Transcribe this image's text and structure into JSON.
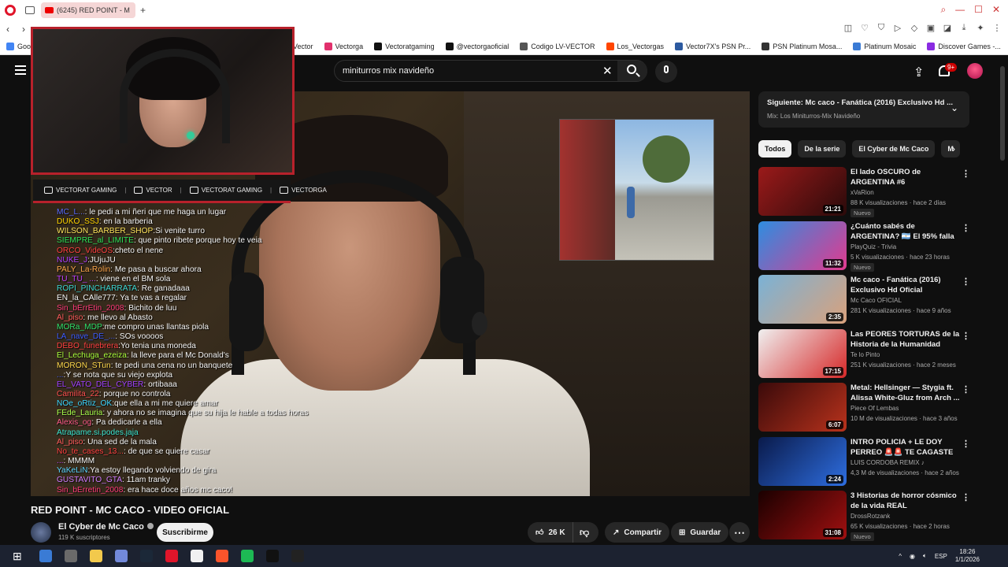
{
  "browser": {
    "tab_title": "(6245) RED POINT - M",
    "bookmarks": [
      {
        "label": "Goog",
        "color": "#4285f4"
      },
      {
        "label": "Vector",
        "color": "#7b4dd8"
      },
      {
        "label": "Vectorga",
        "color": "#e1306c"
      },
      {
        "label": "Vectoratgaming",
        "color": "#111111"
      },
      {
        "label": "@vectorgaoficial",
        "color": "#111111"
      },
      {
        "label": "Codigo LV-VECTOR",
        "color": "#555555"
      },
      {
        "label": "Los_Vectorgas",
        "color": "#ff4500"
      },
      {
        "label": "Vector7X's PSN Pr...",
        "color": "#2c5aa0"
      },
      {
        "label": "PSN Platinum Mosa...",
        "color": "#333333"
      },
      {
        "label": "Platinum Mosaic",
        "color": "#3a7bd5"
      },
      {
        "label": "Discover Games -...",
        "color": "#8a2be2"
      }
    ]
  },
  "youtube": {
    "search_query": "miniturros mix navideño",
    "notifications": "9+"
  },
  "stream": {
    "social": [
      {
        "icon": "youtube-icon",
        "label": "VECTORAT GAMING"
      },
      {
        "icon": "twitch-icon",
        "label": "VECTOR"
      },
      {
        "icon": "twitter-icon",
        "label": "VECTORAT GAMING"
      },
      {
        "icon": "instagram-icon",
        "label": "VECTORGA"
      }
    ],
    "chat": [
      {
        "user": "MC_L...",
        "msg": ": le pedi a mi ñeri que me haga un lugar",
        "color": "#5b6cff"
      },
      {
        "user": "DUKO_SSJ",
        "msg": ": en la barberia",
        "color": "#ffd400"
      },
      {
        "user": "WILSON_BARBER_SHOP",
        "msg": ":Si venite turro",
        "color": "#ffe45c"
      },
      {
        "user": "SIEMPRE_al_LIMITE",
        "msg": ": que pinto ribete porque hoy te veia",
        "color": "#2ee65a"
      },
      {
        "user": "ORCO_VideOS",
        "msg": ":cheto el nene",
        "color": "#ff4040"
      },
      {
        "user": "NUKE_J",
        "msg": ":JUjuJU",
        "color": "#b040ff"
      },
      {
        "user": "PALY_La-Rolin",
        "msg": ": Me pasa a buscar ahora",
        "color": "#ffa84c"
      },
      {
        "user": "TU_TU_ ...",
        "msg": ": viene en el BM sola",
        "color": "#c040ff"
      },
      {
        "user": "ROPI_PINCHARRATA",
        "msg": ": Re ganadaaa",
        "color": "#3dd6d0"
      },
      {
        "user": "EN_la_CAlle777",
        "msg": ": Ya te vas a regalar",
        "color": "#f5f5f5"
      },
      {
        "user": "Sin_bErrEtin_2008",
        "msg": ": Bichito de luu",
        "color": "#ff3c7a"
      },
      {
        "user": "Al_piso",
        "msg": ": me llevo al Abasto",
        "color": "#ff5c5c"
      },
      {
        "user": "MORa_MDP",
        "msg": ":me compro unas llantas piola",
        "color": "#2fe06a"
      },
      {
        "user": "LA_nave_DE_...",
        "msg": ": SOs voooos",
        "color": "#3d5cff"
      },
      {
        "user": "DEBO_funebrera",
        "msg": ":Yo tenia una moneda",
        "color": "#ff4040"
      },
      {
        "user": "El_Lechuga_ezeiza",
        "msg": ": la lleve para el Mc Donald's",
        "color": "#aaff3c"
      },
      {
        "user": "MORON_STun",
        "msg": ": te pedi una cena no un banquete",
        "color": "#ffd84c"
      },
      {
        "user": "...",
        "msg": ":Y se nota que su viejo explota",
        "color": "#3d5cff"
      },
      {
        "user": "EL_VATO_DEL_CYBER",
        "msg": ": ortibaaa",
        "color": "#a040ff"
      },
      {
        "user": "Camilita_22",
        "msg": ": porque no controla",
        "color": "#ff5050"
      },
      {
        "user": "NOe_oRtiz_OK",
        "msg": ":que ella a mi me quiere amar",
        "color": "#3dd6ff"
      },
      {
        "user": "FEde_Lauria",
        "msg": ": y ahora no se imagina que su hija le hable a todas horas",
        "color": "#a8ff4c"
      },
      {
        "user": "Alexis_og",
        "msg": ": Pa dedicarle a ella",
        "color": "#ff5c8a"
      },
      {
        "user": "Atrapame.si.podes.jaja",
        "msg": "",
        "color": "#3de6d0"
      },
      {
        "user": "Al_piso",
        "msg": ": Una sed de la mala",
        "color": "#ff5c5c"
      },
      {
        "user": "No_te_cases_13...",
        "msg": ": de que se quiere casar",
        "color": "#ff4040"
      },
      {
        "user": "...",
        "msg": ": MMMM",
        "color": "#c040ff"
      },
      {
        "user": "YaKeLiN",
        "msg": ":Ya estoy llegando volviendo de gira",
        "color": "#5cd6ff"
      },
      {
        "user": "GUSTAVITO_GTA",
        "msg": ": 11am tranky",
        "color": "#d07cff"
      },
      {
        "user": "Sin_bErretin_2008",
        "msg": ": era hace doce años mc caco!",
        "color": "#ff3c7a"
      }
    ]
  },
  "video": {
    "title": "RED POINT - MC CACO - VIDEO OFICIAL",
    "channel": "El Cyber de Mc Caco",
    "subscribers": "119 K suscriptores",
    "subscribe_label": "Suscribirme",
    "likes": "26 K",
    "share_label": "Compartir",
    "save_label": "Guardar"
  },
  "sidebar": {
    "next_title": "Siguiente: Mc caco - Fanática (2016) Exclusivo Hd ...",
    "next_sub": "Mix: Los Miniturros-Mix Navideño",
    "chips": [
      "Todos",
      "De la serie",
      "El Cyber de Mc Caco",
      "M"
    ],
    "recommendations": [
      {
        "title": "El lado OSCURO de ARGENTINA #6",
        "channel": "xVaRion",
        "meta": "88 K visualizaciones · hace 2 días",
        "badge": "Nuevo",
        "duration": "21:21",
        "thumb_a": "#9b1a1a",
        "thumb_b": "#2a0a0a"
      },
      {
        "title": "¿Cuánto sabés de ARGENTINA? 🇦🇷 El 95% falla la última ...",
        "channel": "PlayQuiz - Trivia",
        "meta": "5 K visualizaciones · hace 23 horas",
        "badge": "Nuevo",
        "duration": "11:32",
        "thumb_a": "#2e8de0",
        "thumb_b": "#e23a8f"
      },
      {
        "title": "Mc caco - Fanática (2016) Exclusivo Hd Oficial",
        "channel": "Mc Caco OFICIAL",
        "meta": "281 K visualizaciones · hace 9 años",
        "badge": "",
        "duration": "2:35",
        "thumb_a": "#7ab2d6",
        "thumb_b": "#d9a17c"
      },
      {
        "title": "Las PEORES TORTURAS de la Historia de la Humanidad",
        "channel": "Te lo Pinto",
        "meta": "251 K visualizaciones · hace 2 meses",
        "badge": "",
        "duration": "17:15",
        "thumb_a": "#f0f0f0",
        "thumb_b": "#d62828"
      },
      {
        "title": "Metal: Hellsinger — Stygia ft. Alissa White-Gluz from Arch ...",
        "channel": "Piece Of Lembas",
        "meta": "10 M de visualizaciones · hace 3 años",
        "badge": "",
        "duration": "6:07",
        "thumb_a": "#3a0a0a",
        "thumb_b": "#b8321c"
      },
      {
        "title": "INTRO POLICIA + LE DOY PERREO 🚨🚨 TE CAGASTE ...",
        "channel": "LUIS CORDOBA REMIX ♪",
        "meta": "4,3 M de visualizaciones · hace 2 años",
        "badge": "",
        "duration": "2:24",
        "thumb_a": "#0a1a4a",
        "thumb_b": "#2e6ee0"
      },
      {
        "title": "3 Historias de horror cósmico de la vida REAL",
        "channel": "DrossRotzank",
        "meta": "65 K visualizaciones · hace 2 horas",
        "badge": "Nuevo",
        "duration": "31:08",
        "thumb_a": "#1a0000",
        "thumb_b": "#a01010"
      }
    ]
  },
  "taskbar": {
    "lang": "ESP",
    "time": "18:26",
    "date": "1/1/2026",
    "apps": [
      "#3a7bd5",
      "#6a6a6a",
      "#f2c94c",
      "#7289da",
      "#1b2838",
      "#e0152a",
      "#f1f1f1",
      "#fb542b",
      "#1db954",
      "#111111",
      "#222222"
    ]
  }
}
